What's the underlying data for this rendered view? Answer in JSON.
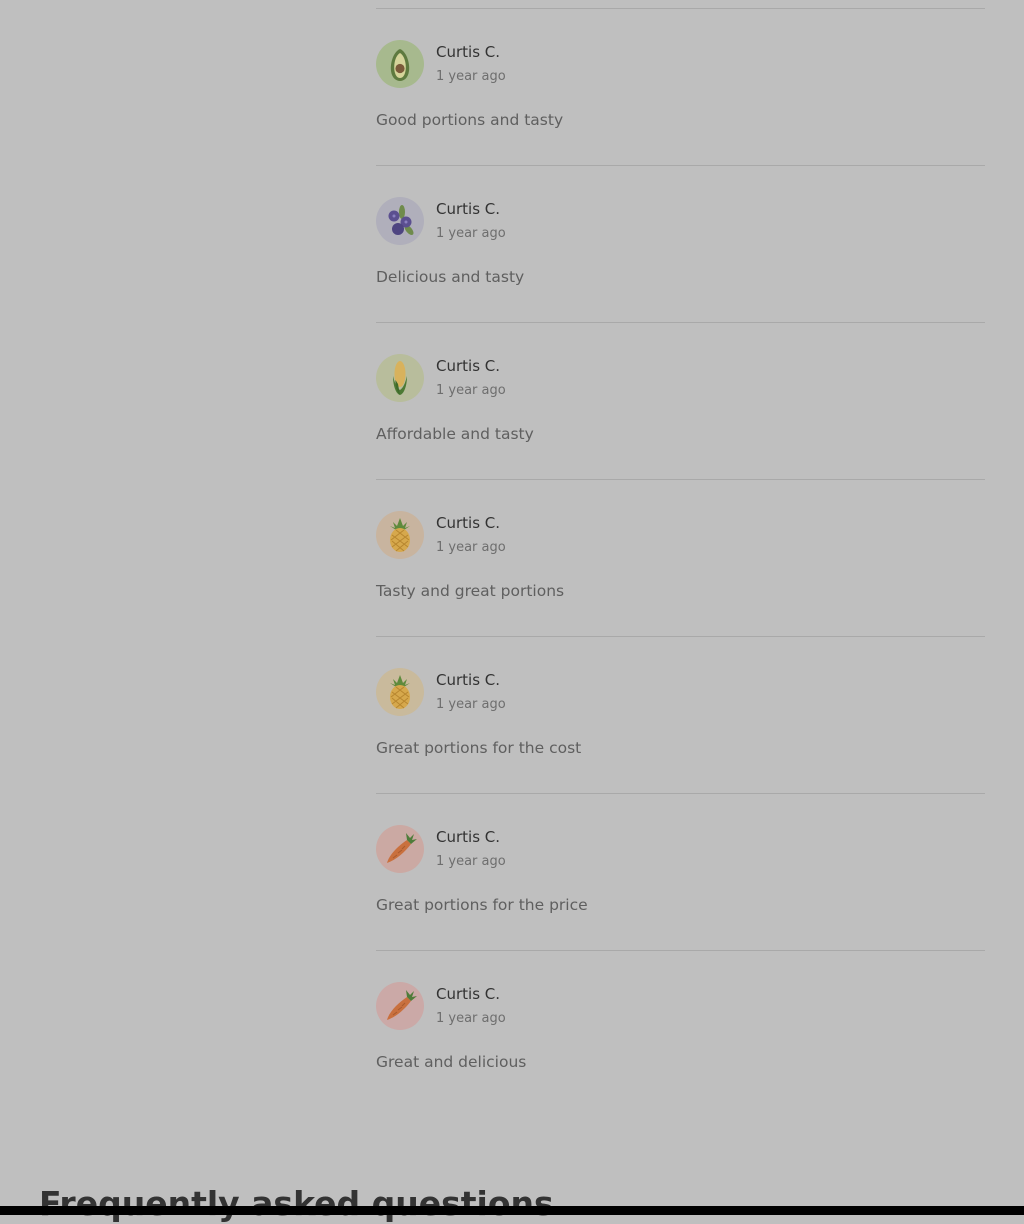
{
  "reviews": [
    {
      "author": "Curtis C.",
      "time": "1 year ago",
      "text": "Good portions and tasty",
      "avatar_icon": "avocado-icon",
      "avatar_bg": "#a7b98e"
    },
    {
      "author": "Curtis C.",
      "time": "1 year ago",
      "text": "Delicious and tasty",
      "avatar_icon": "blueberry-icon",
      "avatar_bg": "#b0afbb"
    },
    {
      "author": "Curtis C.",
      "time": "1 year ago",
      "text": "Affordable and tasty",
      "avatar_icon": "corn-icon",
      "avatar_bg": "#b8bd9c"
    },
    {
      "author": "Curtis C.",
      "time": "1 year ago",
      "text": "Tasty and great portions",
      "avatar_icon": "pineapple-icon",
      "avatar_bg": "#c8b49f"
    },
    {
      "author": "Curtis C.",
      "time": "1 year ago",
      "text": "Great portions for the cost",
      "avatar_icon": "pineapple-icon",
      "avatar_bg": "#c9ba9c"
    },
    {
      "author": "Curtis C.",
      "time": "1 year ago",
      "text": "Great portions for the price",
      "avatar_icon": "carrot-icon",
      "avatar_bg": "#cba9a3"
    },
    {
      "author": "Curtis C.",
      "time": "1 year ago",
      "text": "Great and delicious",
      "avatar_icon": "carrot-icon",
      "avatar_bg": "#cba9a7"
    }
  ],
  "faq": {
    "heading": "Frequently asked questions"
  },
  "colors": {
    "page_background": "#bfbfbf",
    "divider": "#a9a9a9",
    "author_text": "#333333",
    "meta_text": "#6e6e6e",
    "review_text": "#5f5f5f"
  }
}
